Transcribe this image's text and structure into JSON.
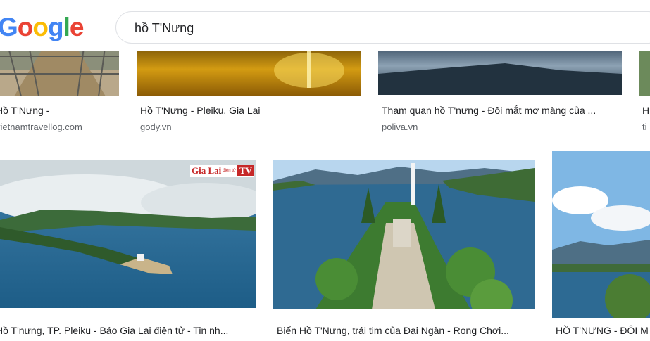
{
  "header": {
    "logo_letters": [
      {
        "ch": "G",
        "color": "#4285f4"
      },
      {
        "ch": "o",
        "color": "#ea4335"
      },
      {
        "ch": "o",
        "color": "#fbbc05"
      },
      {
        "ch": "g",
        "color": "#4285f4"
      },
      {
        "ch": "l",
        "color": "#34a853"
      },
      {
        "ch": "e",
        "color": "#ea4335"
      }
    ],
    "search_query": "hồ T'Nưng"
  },
  "row1": [
    {
      "title": "Hồ T'Nưng -",
      "source": "vietnamtravellog.com"
    },
    {
      "title": "Hồ T'Nưng - Pleiku, Gia Lai",
      "source": "gody.vn"
    },
    {
      "title": "Tham quan hồ T'nưng - Đôi mắt mơ màng của ...",
      "source": "poliva.vn"
    },
    {
      "title": "H",
      "source": "ti"
    }
  ],
  "row2": [
    {
      "title": "Hồ T'nưng, TP. Pleiku - Báo Gia Lai điện tử - Tin nh...",
      "watermark_main": "Gia Lai",
      "watermark_small": "điện tử",
      "watermark_tv": "TV"
    },
    {
      "title": "Biển Hồ T'Nưng, trái tim của Đại Ngàn - Rong Chơi..."
    },
    {
      "title": "HỒ T'NƯNG - ĐÔI M"
    }
  ]
}
